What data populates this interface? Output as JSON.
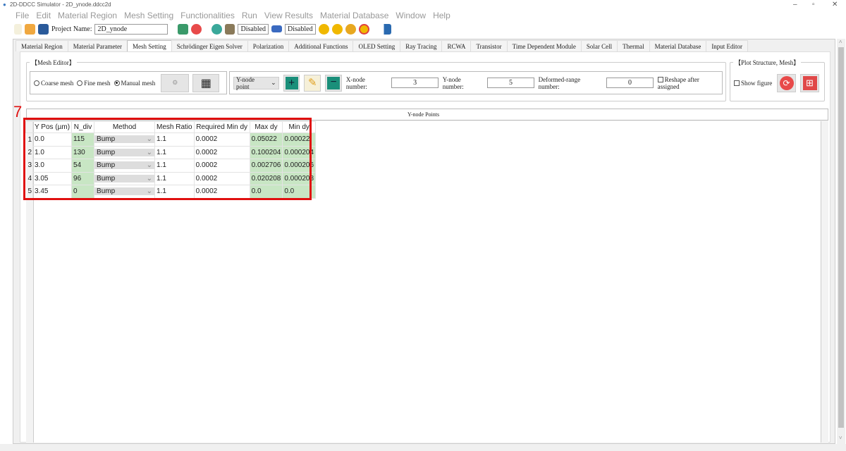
{
  "window": {
    "title": "2D-DDCC Simulator - 2D_ynode.ddcc2d",
    "minimize": "–",
    "maximize": "▫",
    "close": "✕"
  },
  "menu": [
    "File",
    "Edit",
    "Material Region",
    "Mesh Setting",
    "Functionalities",
    "Run",
    "View Results",
    "Material Database",
    "Window",
    "Help"
  ],
  "toolbar": {
    "project_label": "Project Name:",
    "project_name": "2D_ynode",
    "disabled1": "Disabled",
    "disabled2": "Disabled"
  },
  "tabs": [
    "Material Region",
    "Material Parameter",
    "Mesh Setting",
    "Schrödinger Eigen Solver",
    "Polarization",
    "Additional Functions",
    "OLED Setting",
    "Ray Tracing",
    "RCWA",
    "Transistor",
    "Time Dependent Module",
    "Solar Cell",
    "Thermal",
    "Material Database",
    "Input Editor"
  ],
  "active_tab": "Mesh Setting",
  "mesh_editor": {
    "title": "【Mesh Editor】",
    "coarse": "Coarse mesh",
    "fine": "Fine mesh",
    "manual": "Manual mesh",
    "selected": "Manual mesh",
    "node_select": "Y-node point",
    "x_label": "X-node number:",
    "x_value": "3",
    "y_label": "Y-node number:",
    "y_value": "5",
    "def_label": "Deformed-range number:",
    "def_value": "0",
    "reshape": "Reshape after assigned"
  },
  "plot": {
    "title": "【Plot Structure, Mesh】",
    "show_figure": "Show figure"
  },
  "annotation": "7",
  "panel_title": "Y-node Points",
  "table": {
    "headers": [
      "Y Pos (µm)",
      "N_div",
      "Method",
      "Mesh Ratio",
      "Required Min dy",
      "Max dy",
      "Min dy"
    ],
    "rows": [
      {
        "i": "1",
        "ypos": "0.0",
        "ndiv": "115",
        "method": "Bump",
        "ratio": "1.1",
        "req": "0.0002",
        "max": "0.05022",
        "min": "0.00022"
      },
      {
        "i": "2",
        "ypos": "1.0",
        "ndiv": "130",
        "method": "Bump",
        "ratio": "1.1",
        "req": "0.0002",
        "max": "0.100204",
        "min": "0.000204"
      },
      {
        "i": "3",
        "ypos": "3.0",
        "ndiv": "54",
        "method": "Bump",
        "ratio": "1.1",
        "req": "0.0002",
        "max": "0.002706",
        "min": "0.000206"
      },
      {
        "i": "4",
        "ypos": "3.05",
        "ndiv": "96",
        "method": "Bump",
        "ratio": "1.1",
        "req": "0.0002",
        "max": "0.020208",
        "min": "0.000208"
      },
      {
        "i": "5",
        "ypos": "3.45",
        "ndiv": "0",
        "method": "Bump",
        "ratio": "1.1",
        "req": "0.0002",
        "max": "0.0",
        "min": "0.0"
      }
    ]
  },
  "colors": {
    "highlight": "#c8e6c4",
    "annotation": "#e01010",
    "teal": "#1a8f7a",
    "red_button": "#e04848"
  }
}
